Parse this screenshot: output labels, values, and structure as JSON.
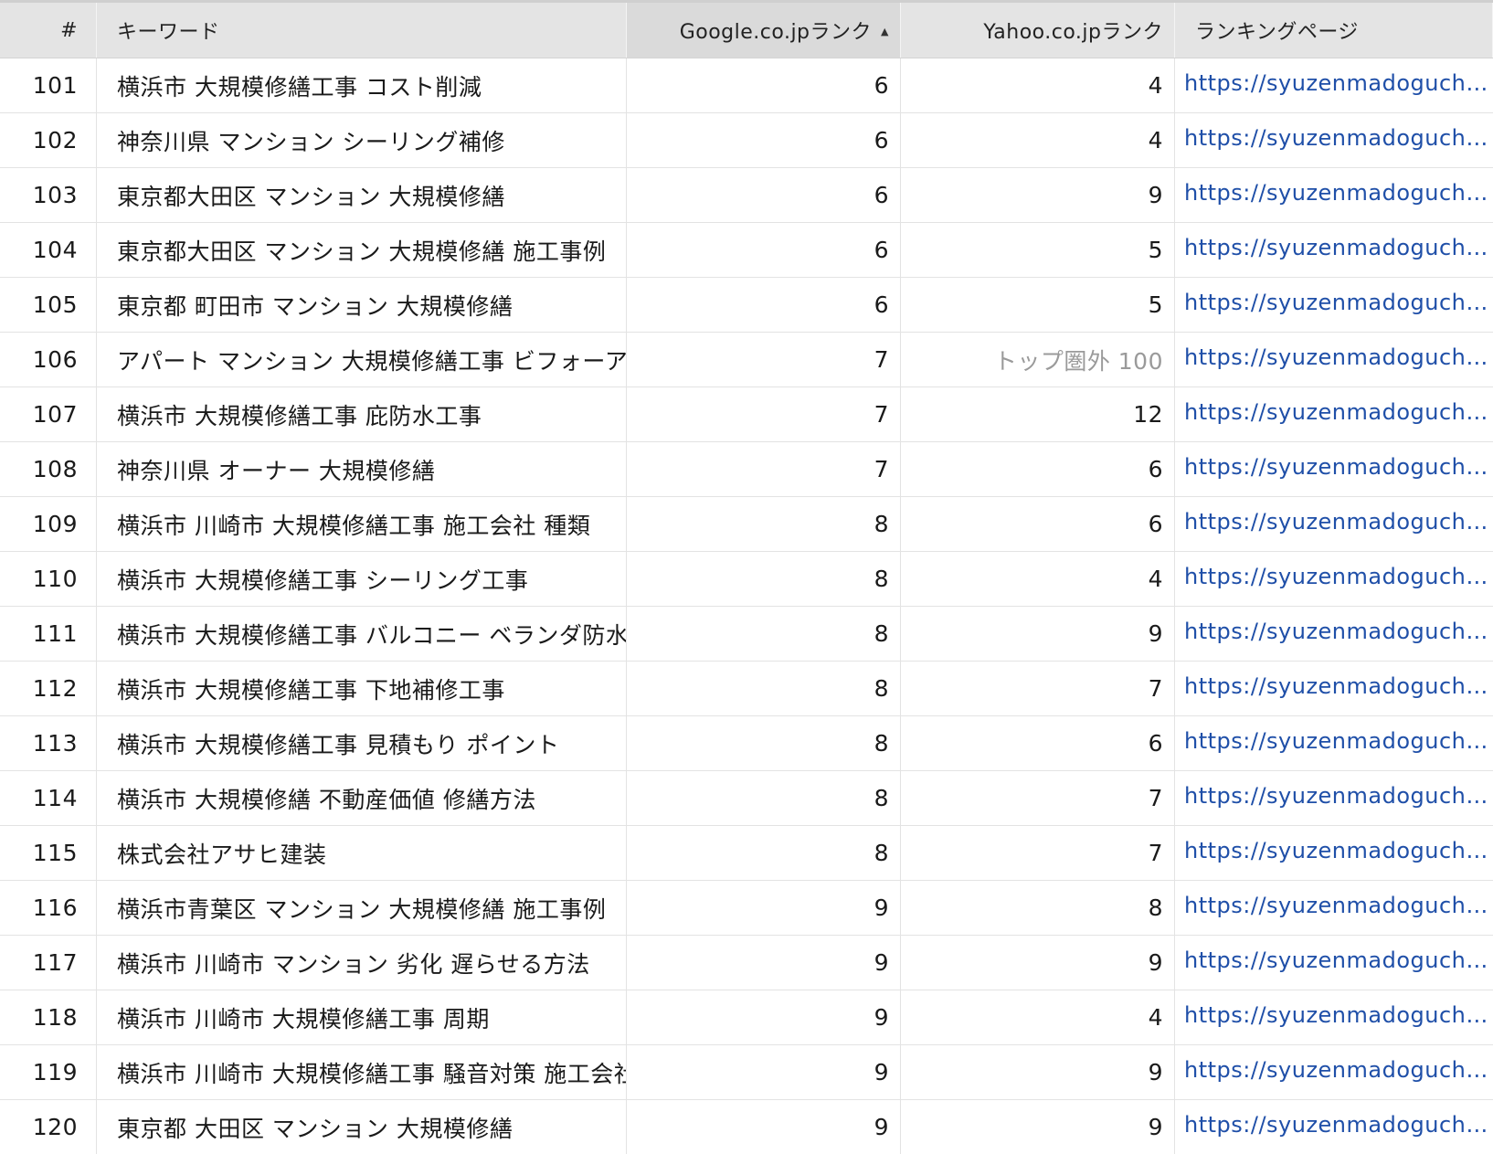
{
  "header": {
    "num": "#",
    "keyword": "キーワード",
    "google": "Google.co.jpランク",
    "yahoo": "Yahoo.co.jpランク",
    "page": "ランキングページ",
    "sort_indicator": "▲"
  },
  "rows": [
    {
      "num": "101",
      "keyword": "横浜市 大規模修繕工事 コスト削減",
      "google": "6",
      "yahoo": "4",
      "page": "https://syuzenmadoguchi...."
    },
    {
      "num": "102",
      "keyword": "神奈川県 マンション シーリング補修",
      "google": "6",
      "yahoo": "4",
      "page": "https://syuzenmadoguchi...."
    },
    {
      "num": "103",
      "keyword": "東京都大田区 マンション 大規模修繕",
      "google": "6",
      "yahoo": "9",
      "page": "https://syuzenmadoguchi...."
    },
    {
      "num": "104",
      "keyword": "東京都大田区 マンション 大規模修繕 施工事例",
      "google": "6",
      "yahoo": "5",
      "page": "https://syuzenmadoguchi...."
    },
    {
      "num": "105",
      "keyword": "東京都 町田市 マンション 大規模修繕",
      "google": "6",
      "yahoo": "5",
      "page": "https://syuzenmadoguchi...."
    },
    {
      "num": "106",
      "keyword": "アパート マンション 大規模修繕工事 ビフォーアフター",
      "google": "7",
      "yahoo": "トップ圏外 100",
      "page": "https://syuzenmadoguchi...."
    },
    {
      "num": "107",
      "keyword": "横浜市 大規模修繕工事 庇防水工事",
      "google": "7",
      "yahoo": "12",
      "page": "https://syuzenmadoguchi...."
    },
    {
      "num": "108",
      "keyword": "神奈川県 オーナー 大規模修繕",
      "google": "7",
      "yahoo": "6",
      "page": "https://syuzenmadoguchi...."
    },
    {
      "num": "109",
      "keyword": "横浜市 川崎市 大規模修繕工事 施工会社 種類",
      "google": "8",
      "yahoo": "6",
      "page": "https://syuzenmadoguchi...."
    },
    {
      "num": "110",
      "keyword": "横浜市 大規模修繕工事 シーリング工事",
      "google": "8",
      "yahoo": "4",
      "page": "https://syuzenmadoguchi...."
    },
    {
      "num": "111",
      "keyword": "横浜市 大規模修繕工事 バルコニー ベランダ防水工事",
      "google": "8",
      "yahoo": "9",
      "page": "https://syuzenmadoguchi...."
    },
    {
      "num": "112",
      "keyword": "横浜市 大規模修繕工事 下地補修工事",
      "google": "8",
      "yahoo": "7",
      "page": "https://syuzenmadoguchi...."
    },
    {
      "num": "113",
      "keyword": "横浜市 大規模修繕工事 見積もり ポイント",
      "google": "8",
      "yahoo": "6",
      "page": "https://syuzenmadoguchi...."
    },
    {
      "num": "114",
      "keyword": "横浜市 大規模修繕 不動産価値 修繕方法",
      "google": "8",
      "yahoo": "7",
      "page": "https://syuzenmadoguchi...."
    },
    {
      "num": "115",
      "keyword": "株式会社アサヒ建装",
      "google": "8",
      "yahoo": "7",
      "page": "https://syuzenmadoguchi...."
    },
    {
      "num": "116",
      "keyword": "横浜市青葉区 マンション 大規模修繕 施工事例",
      "google": "9",
      "yahoo": "8",
      "page": "https://syuzenmadoguchi...."
    },
    {
      "num": "117",
      "keyword": "横浜市 川崎市 マンション 劣化 遅らせる方法",
      "google": "9",
      "yahoo": "9",
      "page": "https://syuzenmadoguchi...."
    },
    {
      "num": "118",
      "keyword": "横浜市 川崎市 大規模修繕工事 周期",
      "google": "9",
      "yahoo": "4",
      "page": "https://syuzenmadoguchi...."
    },
    {
      "num": "119",
      "keyword": "横浜市 川崎市 大規模修繕工事 騒音対策 施工会社",
      "google": "9",
      "yahoo": "9",
      "page": "https://syuzenmadoguchi...."
    },
    {
      "num": "120",
      "keyword": "東京都 大田区 マンション 大規模修繕",
      "google": "9",
      "yahoo": "9",
      "page": "https://syuzenmadoguchi...."
    }
  ]
}
